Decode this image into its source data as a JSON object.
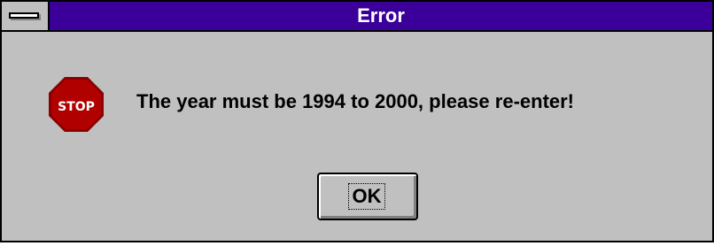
{
  "dialog": {
    "title": "Error",
    "message": "The year must be 1994 to 2000, please re-enter!",
    "icon": "stop-icon",
    "icon_text": "STOP",
    "ok_label": "OK"
  },
  "colors": {
    "titlebar": "#3b0099",
    "title_text": "#ffffff",
    "face": "#c0c0c0",
    "stop_fill": "#b00000",
    "stop_text": "#ffffff"
  }
}
